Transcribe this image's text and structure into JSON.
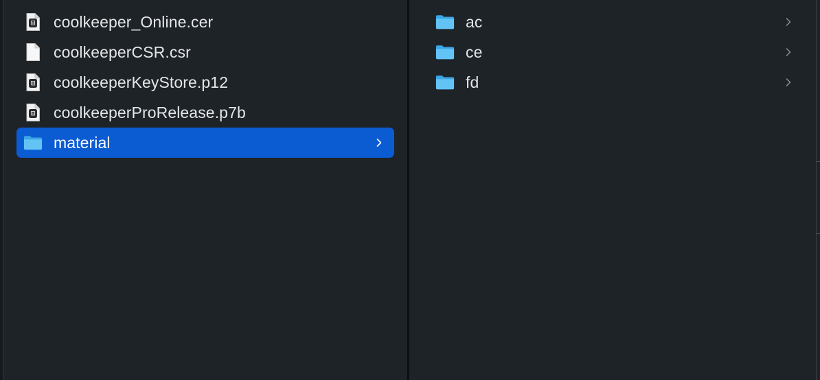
{
  "columns": [
    {
      "items": [
        {
          "name": "coolkeeper_Online.cer",
          "icon": "certificate-file-icon"
        },
        {
          "name": "coolkeeperCSR.csr",
          "icon": "blank-document-icon"
        },
        {
          "name": "coolkeeperKeyStore.p12",
          "icon": "certificate-file-icon"
        },
        {
          "name": "coolkeeperProRelease.p7b",
          "icon": "certificate-file-icon"
        },
        {
          "name": "material",
          "icon": "folder-icon",
          "selected": true,
          "has_children": true
        }
      ]
    },
    {
      "items": [
        {
          "name": "ac",
          "icon": "folder-icon",
          "has_children": true
        },
        {
          "name": "ce",
          "icon": "folder-icon",
          "has_children": true
        },
        {
          "name": "fd",
          "icon": "folder-icon",
          "has_children": true
        }
      ]
    }
  ],
  "colors": {
    "background": "#1e2327",
    "selection": "#0b5bd3",
    "folder": "#4fb6ee",
    "text": "#e4e6e8"
  }
}
